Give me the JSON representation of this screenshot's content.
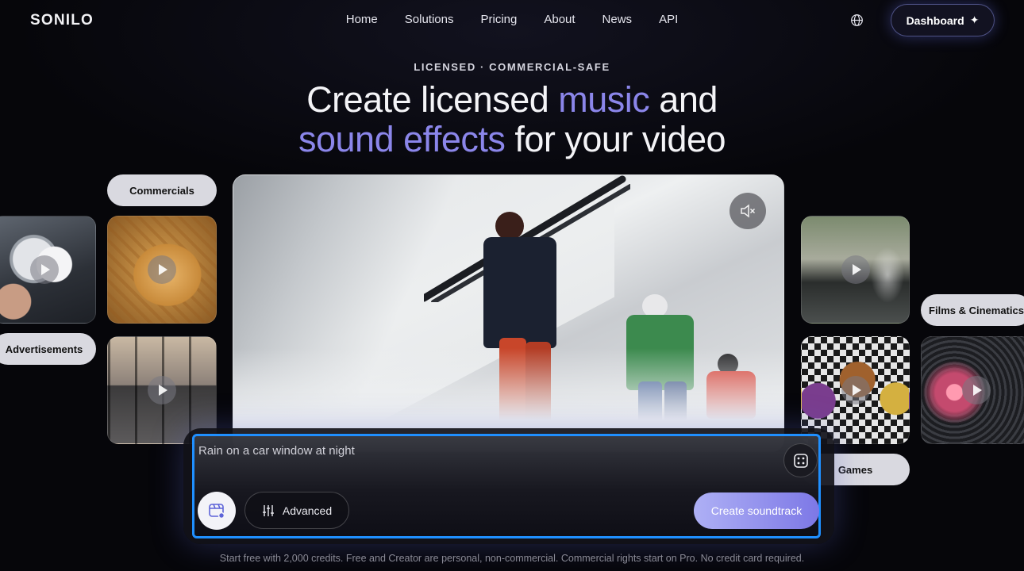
{
  "header": {
    "logo": "SONILO",
    "nav": [
      "Home",
      "Solutions",
      "Pricing",
      "About",
      "News",
      "API"
    ],
    "dashboard_label": "Dashboard",
    "globe_icon": "globe-icon",
    "sparkle_icon": "sparkle-icon"
  },
  "hero": {
    "eyebrow": "LICENSED · COMMERCIAL-SAFE",
    "line1_pre": "Create licensed ",
    "line1_accent": "music",
    "line1_post": " and",
    "line2_accent": "sound effects",
    "line2_post": " for your video",
    "accent_color": "#8b86ea"
  },
  "categories": {
    "commercials": "Commercials",
    "advertisements": "Advertisements",
    "films": "Films & Cinematics",
    "games": "Games"
  },
  "prompt": {
    "placeholder": "Rain on a car window at night",
    "advanced_label": "Advanced",
    "create_label": "Create soundtrack"
  },
  "footnote": "Start free with 2,000 credits. Free and Creator are personal, non-commercial. Commercial rights start on Pro. No credit card required."
}
